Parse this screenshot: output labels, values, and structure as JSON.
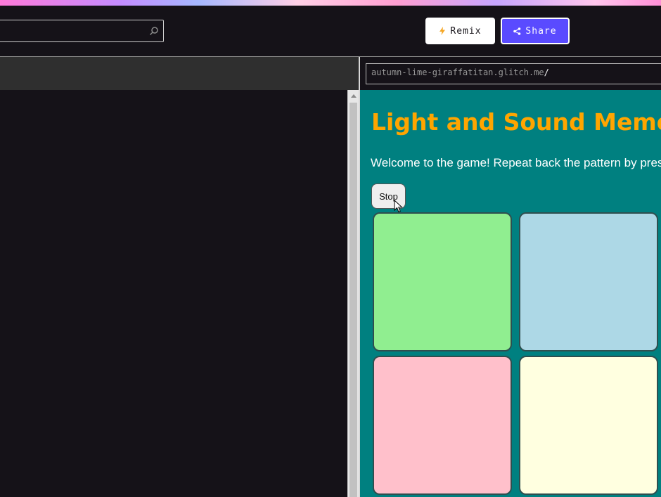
{
  "toolbar": {
    "remix_label": "Remix",
    "share_label": "Share",
    "accent_color": "#5a4bff"
  },
  "preview": {
    "url_host": "autumn-lime-giraffatitan.glitch.me",
    "url_path": "/",
    "background_color": "#008080"
  },
  "game": {
    "title": "Light and Sound Memo",
    "intro": "Welcome to the game! Repeat back the pattern by pressin",
    "stop_label": "Stop",
    "pads": [
      {
        "color": "#90ee90"
      },
      {
        "color": "#add8e6"
      },
      {
        "color": "#ffc0cb"
      },
      {
        "color": "#ffffe0"
      }
    ]
  },
  "icons": {
    "search": "search-icon",
    "remix": "lightning-icon",
    "share": "share-icon",
    "cursor": "mouse-pointer-icon"
  }
}
